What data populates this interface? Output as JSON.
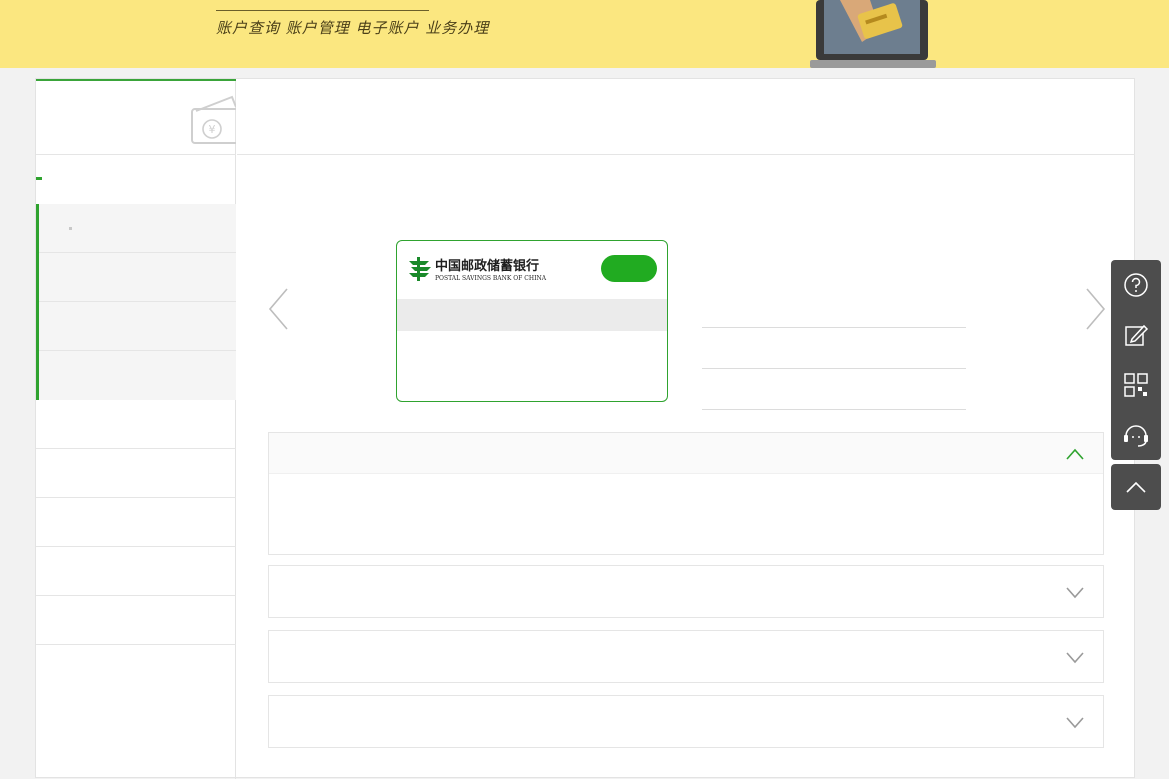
{
  "banner": {
    "slogan": "账户查询 账户管理 电子账户 业务办理",
    "background": "#fbe780"
  },
  "card": {
    "bank_name_cn": "中国邮政储蓄银行",
    "bank_name_en": "POSTAL SAVINGS BANK OF CHINA",
    "brand_color": "#21ab21"
  },
  "icons": {
    "help": "question-circle-icon",
    "edit": "edit-note-icon",
    "qr": "qr-code-icon",
    "service": "headset-service-icon",
    "top": "chevron-up-icon"
  }
}
